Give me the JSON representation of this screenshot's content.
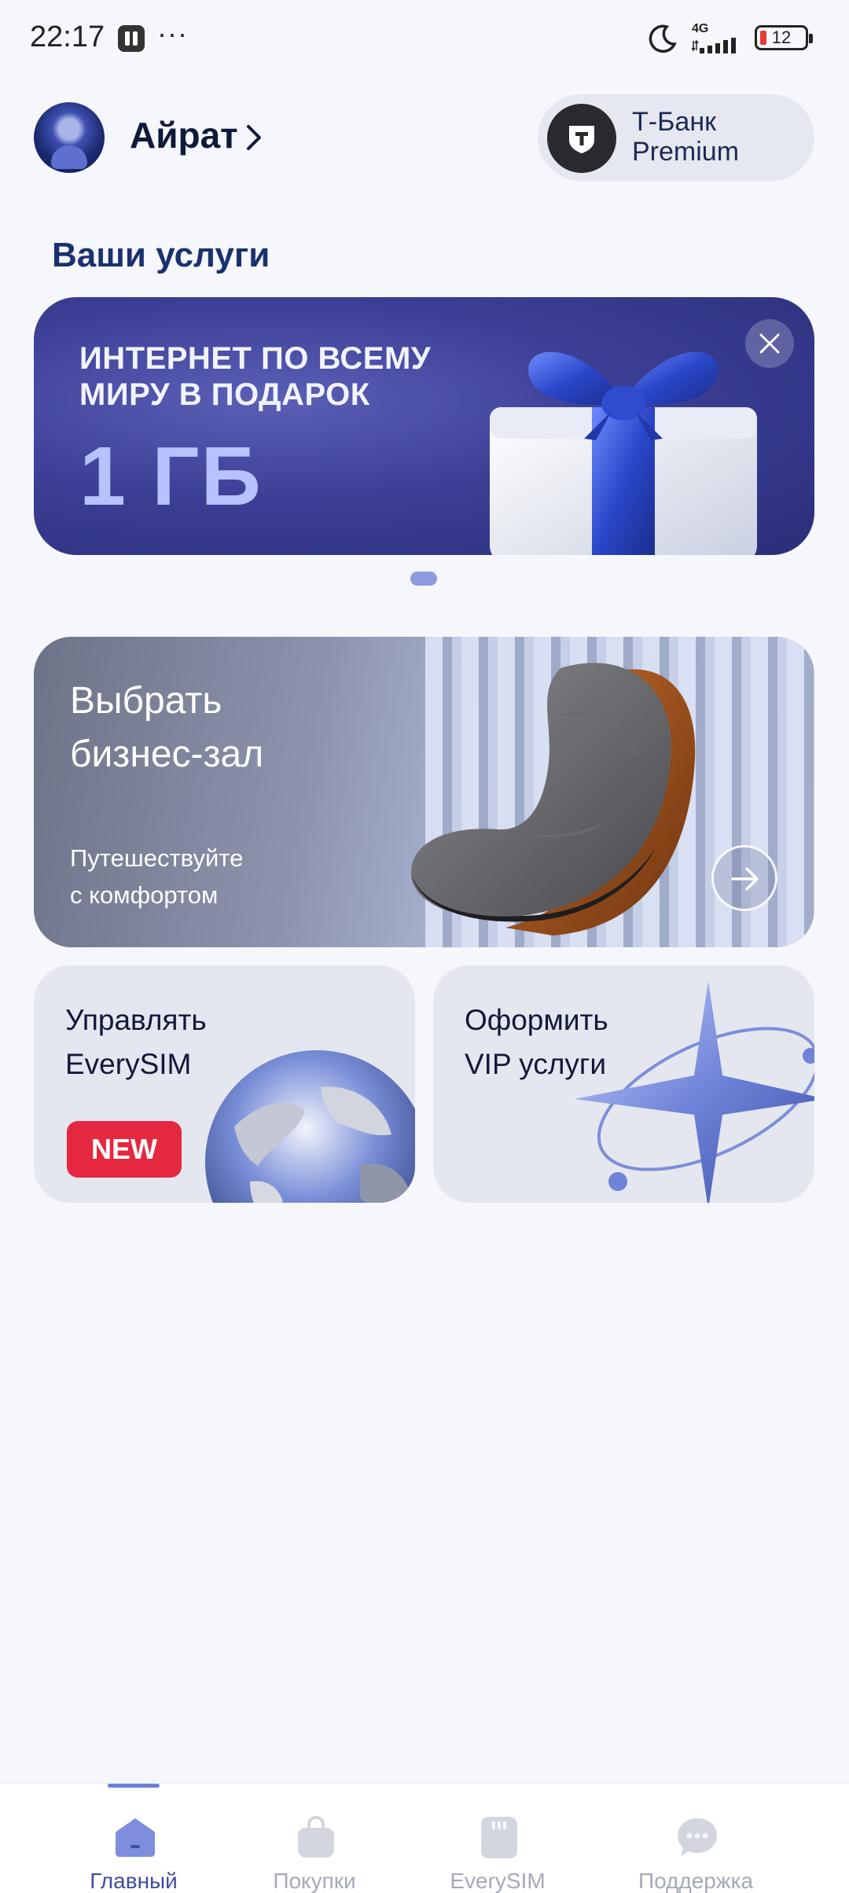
{
  "status_bar": {
    "time": "22:17",
    "dots": "···",
    "network": "4G",
    "battery": "12"
  },
  "header": {
    "user_name": "Айрат",
    "premium": {
      "line1": "Т-Банк",
      "line2": "Premium"
    }
  },
  "section_title": "Ваши услуги",
  "promo": {
    "title": "ИНТЕРНЕТ ПО ВСЕМУ\nМИРУ В ПОДАРОК",
    "value": "1 ГБ"
  },
  "lounge_card": {
    "title": "Выбрать\nбизнес-зал",
    "subtitle": "Путешествуйте\nс комфортом"
  },
  "everysim_card": {
    "title": "Управлять\nEverySIM",
    "badge": "NEW"
  },
  "vip_card": {
    "title": "Оформить\nVIP услуги"
  },
  "bottom_nav": {
    "items": [
      {
        "label": "Главный",
        "icon": "home-icon",
        "active": true
      },
      {
        "label": "Покупки",
        "icon": "shopping-bag-icon",
        "active": false
      },
      {
        "label": "EverySIM",
        "icon": "sim-card-icon",
        "active": false
      },
      {
        "label": "Поддержка",
        "icon": "chat-bubble-icon",
        "active": false
      }
    ]
  },
  "colors": {
    "accent": "#3F4D9E",
    "badge": "#E5283F",
    "promo_bg": "#3C3F95",
    "page_bg": "#F5F7FC"
  }
}
